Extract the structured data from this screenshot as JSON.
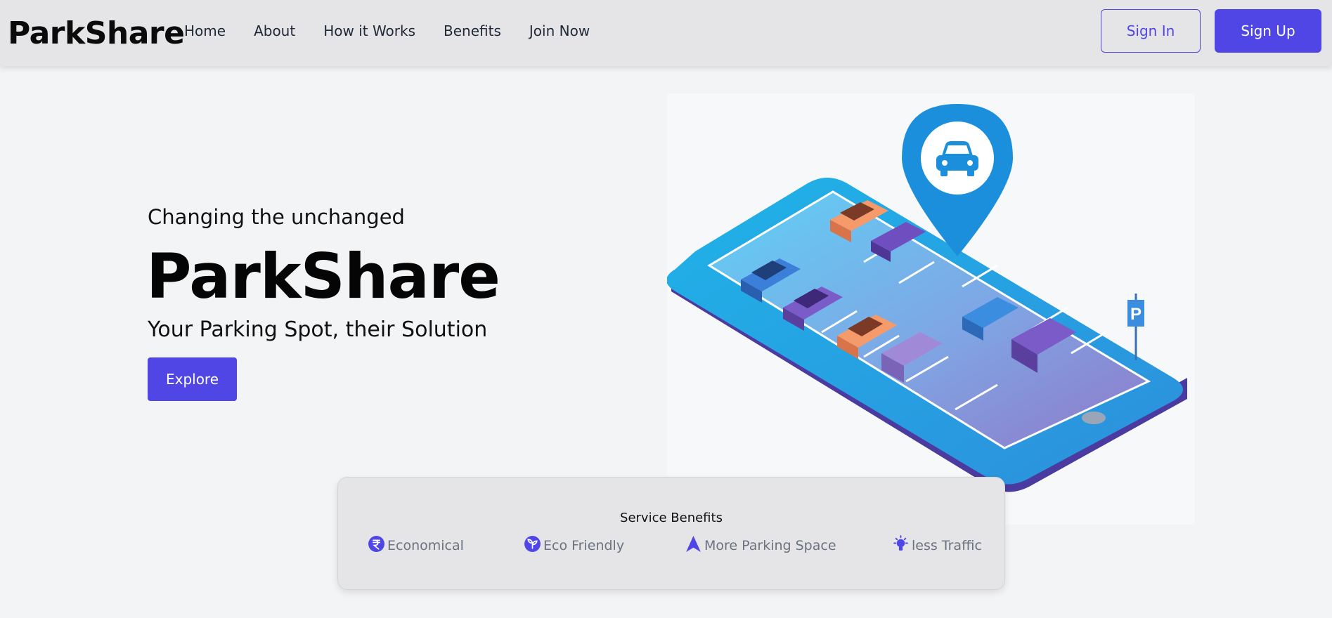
{
  "navbar": {
    "brand": "ParkShare",
    "links": [
      "Home",
      "About",
      "How it Works",
      "Benefits",
      "Join Now"
    ],
    "sign_in": "Sign In",
    "sign_up": "Sign Up"
  },
  "hero": {
    "tagline": "Changing the unchanged",
    "title": "ParkShare",
    "subtitle": "Your Parking Spot, their Solution",
    "explore": "Explore"
  },
  "benefits": {
    "title": "Service Benefits",
    "items": [
      {
        "label": "Economical",
        "icon": "rupee-icon"
      },
      {
        "label": "Eco Friendly",
        "icon": "leaf-icon"
      },
      {
        "label": "More Parking Space",
        "icon": "arrow-up-icon"
      },
      {
        "label": "less Traffic",
        "icon": "lightbulb-icon"
      }
    ]
  },
  "colors": {
    "accent": "#4f46e5",
    "navbar_bg": "#e5e5e7",
    "page_bg": "#f3f4f6"
  }
}
